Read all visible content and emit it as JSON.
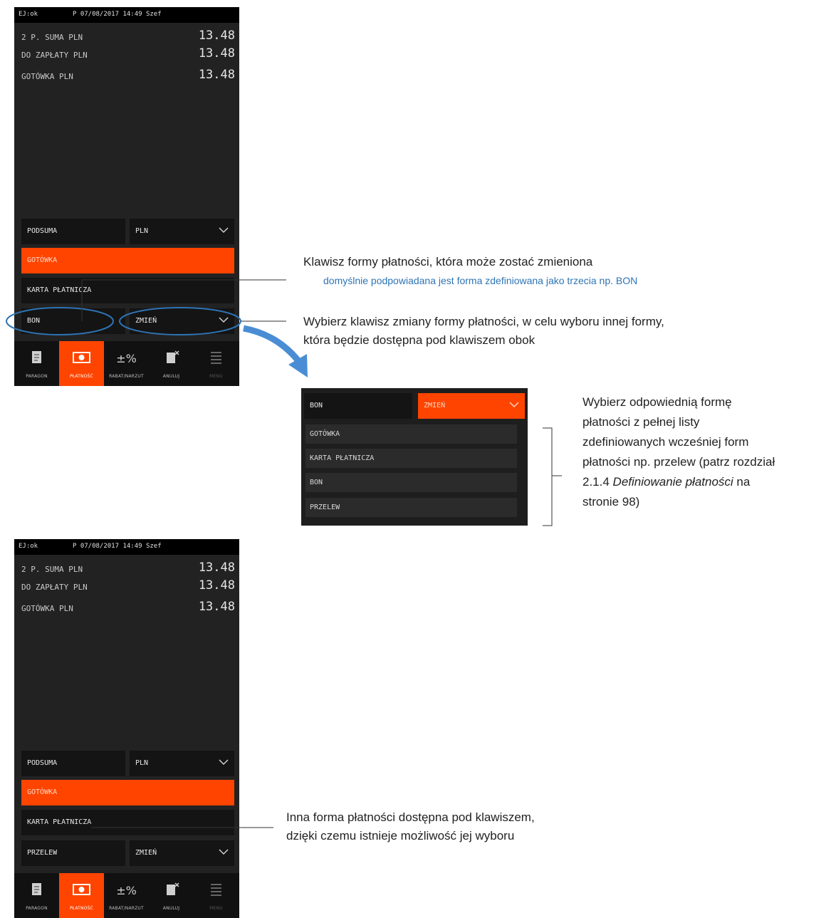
{
  "screen_1": {
    "status_ej": "EJ:ok",
    "status_datetime": "P 07/08/2017 14:49 Szef",
    "summary": [
      {
        "label": "2 P. SUMA PLN",
        "value": "13.48"
      },
      {
        "label": "DO ZAPŁATY PLN",
        "value": "13.48"
      },
      {
        "label": "GOTÓWKA PLN",
        "value": "13.48"
      }
    ],
    "keys": {
      "podsuma": "PODSUMA",
      "currency": "PLN",
      "gotowka": "GOTÓWKA",
      "karta": "KARTA PŁATNICZA",
      "third_form": "BON",
      "change": "ZMIEŃ"
    }
  },
  "screen_2": {
    "status_ej": "EJ:ok",
    "status_datetime": "P 07/08/2017 14:49 Szef",
    "summary": [
      {
        "label": "2 P. SUMA PLN",
        "value": "13.48"
      },
      {
        "label": "DO ZAPŁATY PLN",
        "value": "13.48"
      },
      {
        "label": "GOTÓWKA PLN",
        "value": "13.48"
      }
    ],
    "keys": {
      "podsuma": "PODSUMA",
      "currency": "PLN",
      "gotowka": "GOTÓWKA",
      "karta": "KARTA PŁATNICZA",
      "third_form": "PRZELEW",
      "change": "ZMIEŃ"
    }
  },
  "nav": [
    {
      "label": "PARAGON",
      "icon": "receipt-icon"
    },
    {
      "label": "PŁATNOŚĆ",
      "icon": "cash-icon"
    },
    {
      "label": "RABAT/NARZUT",
      "icon": "percent-icon"
    },
    {
      "label": "ANULUJ",
      "icon": "cancel-receipt-icon"
    },
    {
      "label": "MENU",
      "icon": "menu-icon"
    }
  ],
  "popup": {
    "selected_form": "BON",
    "change_label": "ZMIEŃ",
    "options": [
      "GOTÓWKA",
      "KARTA PŁATNICZA",
      "BON",
      "PRZELEW"
    ]
  },
  "annotations": {
    "a1_line1": "Klawisz formy płatności, która może zostać zmieniona",
    "a1_line2": "domyślnie podpowiadana jest forma zdefiniowana jako trzecia np. BON",
    "a2_line1": "Wybierz klawisz zmiany formy płatności, w celu wyboru innej formy,",
    "a2_line2": "która będzie dostępna pod klawiszem obok",
    "a3_line1": "Wybierz odpowiednią formę",
    "a3_line2": "płatności z pełnej listy",
    "a3_line3": "zdefiniowanych wcześniej form",
    "a3_line4": "płatności np. przelew (patrz rozdział",
    "a3_line5_prefix": "2.1.4 ",
    "a3_line5_italic": "Definiowanie płatności",
    "a3_line5_suffix": " na",
    "a3_line6": "stronie 98)",
    "a4_line1": "Inna forma płatności dostępna pod klawiszem,",
    "a4_line2": "dzięki czemu istnieje możliwość jej wyboru"
  },
  "colors": {
    "accent": "#ff4400",
    "callout_blue": "#2e74b5"
  }
}
